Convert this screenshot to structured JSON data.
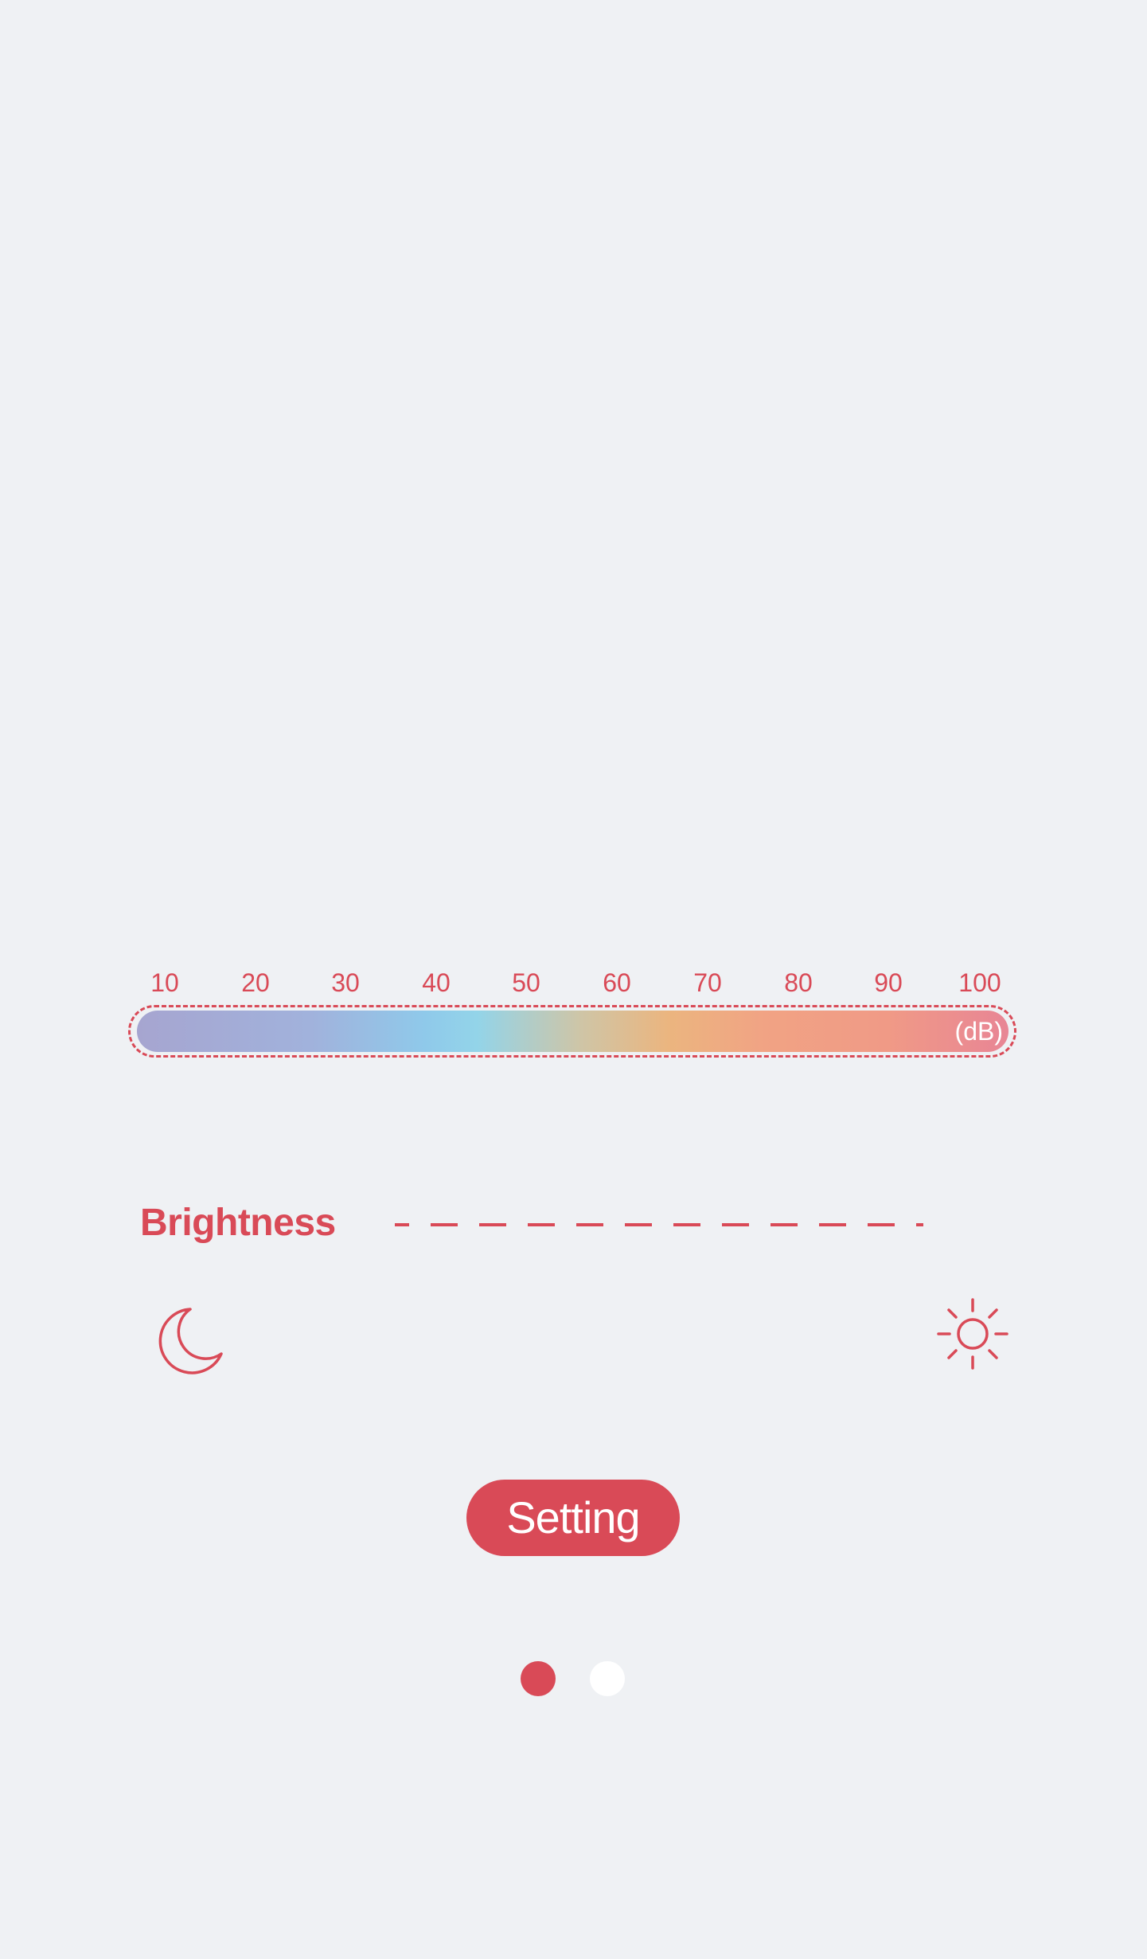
{
  "db_scale": {
    "ticks": [
      "10",
      "20",
      "30",
      "40",
      "50",
      "60",
      "70",
      "80",
      "90",
      "100"
    ],
    "unit": "(dB)",
    "gradient_colors": [
      "#a6a5d0",
      "#a1b2dc",
      "#8fc9ea",
      "#93d4e9",
      "#cfc5a6",
      "#ebb57f",
      "#f1a384",
      "#f09a86",
      "#e88595"
    ]
  },
  "brightness": {
    "label": "Brightness",
    "min_icon": "moon-icon",
    "max_icon": "sun-icon"
  },
  "setting_button": {
    "label": "Setting"
  },
  "pager": {
    "page_count": 2,
    "current_page": 1
  },
  "colors": {
    "accent": "#d94a57",
    "background": "#eff1f4",
    "inactive_dot": "#ffffff"
  }
}
